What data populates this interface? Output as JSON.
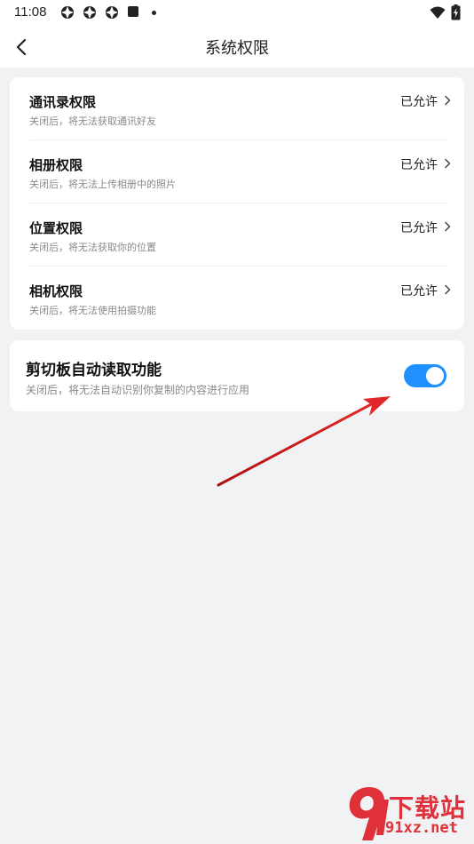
{
  "status_bar": {
    "time": "11:08"
  },
  "header": {
    "title": "系统权限"
  },
  "permissions": [
    {
      "title": "通讯录权限",
      "desc": "关闭后，将无法获取通讯好友",
      "status": "已允许"
    },
    {
      "title": "相册权限",
      "desc": "关闭后，将无法上传相册中的照片",
      "status": "已允许"
    },
    {
      "title": "位置权限",
      "desc": "关闭后，将无法获取你的位置",
      "status": "已允许"
    },
    {
      "title": "相机权限",
      "desc": "关闭后，将无法使用拍摄功能",
      "status": "已允许"
    }
  ],
  "clipboard": {
    "title": "剪切板自动读取功能",
    "desc": "关闭后，将无法自动识别你复制的内容进行应用",
    "enabled": true
  },
  "watermark": {
    "brand": "下载站",
    "domain": "91xz.net"
  },
  "colors": {
    "accent": "#1e90ff",
    "annotation": "#d42020"
  }
}
